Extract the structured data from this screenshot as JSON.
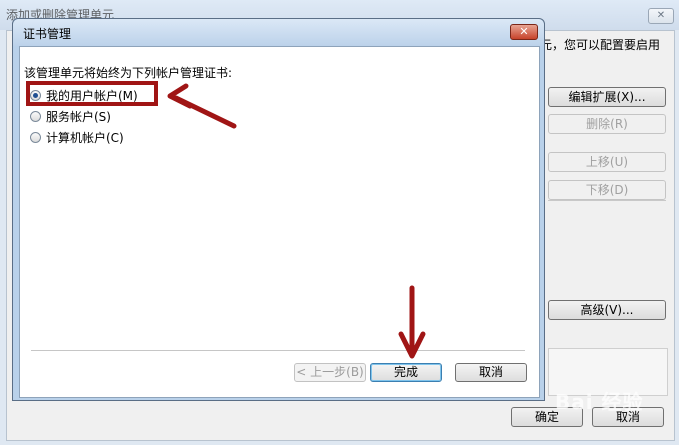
{
  "background_window": {
    "title": "添加或删除管理单元",
    "close_label": "✕",
    "description": "元，您可以配置要启用",
    "buttons": {
      "edit_extensions": "编辑扩展(X)...",
      "remove": "删除(R)",
      "move_up": "上移(U)",
      "move_down": "下移(D)",
      "advanced": "高级(V)...",
      "ok": "确定",
      "cancel": "取消"
    }
  },
  "dialog": {
    "title": "证书管理",
    "close_label": "✕",
    "prompt": "该管理单元将始终为下列帐户管理证书:",
    "options": [
      {
        "label": "我的用户帐户(M)",
        "selected": true
      },
      {
        "label": "服务帐户(S)",
        "selected": false
      },
      {
        "label": "计算机帐户(C)",
        "selected": false
      }
    ],
    "buttons": {
      "back": "< 上一步(B)",
      "finish": "完成",
      "cancel": "取消"
    }
  },
  "watermark": "Bai 经验",
  "colors": {
    "annotation_red": "#a01515",
    "dialog_frame": "#b9d1ea"
  }
}
